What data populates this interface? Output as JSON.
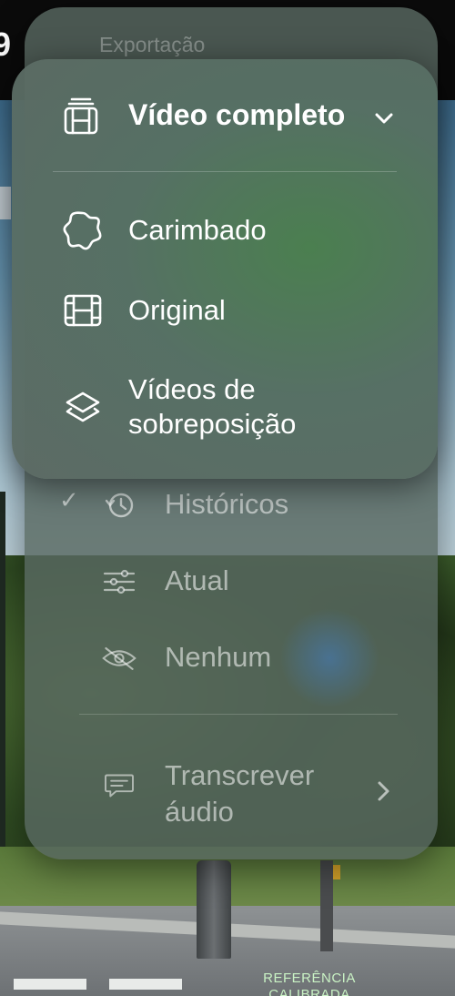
{
  "background": {
    "reference_label_line1": "REFERÊNCIA",
    "reference_label_line2": "CALIBRADA"
  },
  "back_menu": {
    "title": "Exportação",
    "items": [
      {
        "label": "Históricos",
        "icon": "history-icon",
        "checked": true
      },
      {
        "label": "Atual",
        "icon": "sliders-icon",
        "checked": false
      },
      {
        "label": "Nenhum",
        "icon": "eye-slash-icon",
        "checked": false
      }
    ],
    "check_mark": "✓",
    "transcribe": {
      "label_line1": "Transcrever",
      "label_line2": "áudio",
      "icon": "speech-bubble-icon"
    }
  },
  "front_menu": {
    "header": {
      "label": "Vídeo completo",
      "icon": "film-stack-icon"
    },
    "items": [
      {
        "label": "Carimbado",
        "icon": "badge-icon"
      },
      {
        "label": "Original",
        "icon": "film-icon"
      },
      {
        "label_line1": "Vídeos de",
        "label_line2": "sobreposição",
        "icon": "layers-icon"
      }
    ]
  },
  "colors": {
    "menu_text": "#ffffff",
    "dimmed_text": "#b9c2bd",
    "menu_glass": "#5c6a64",
    "accent_glow": "#4a804e"
  }
}
